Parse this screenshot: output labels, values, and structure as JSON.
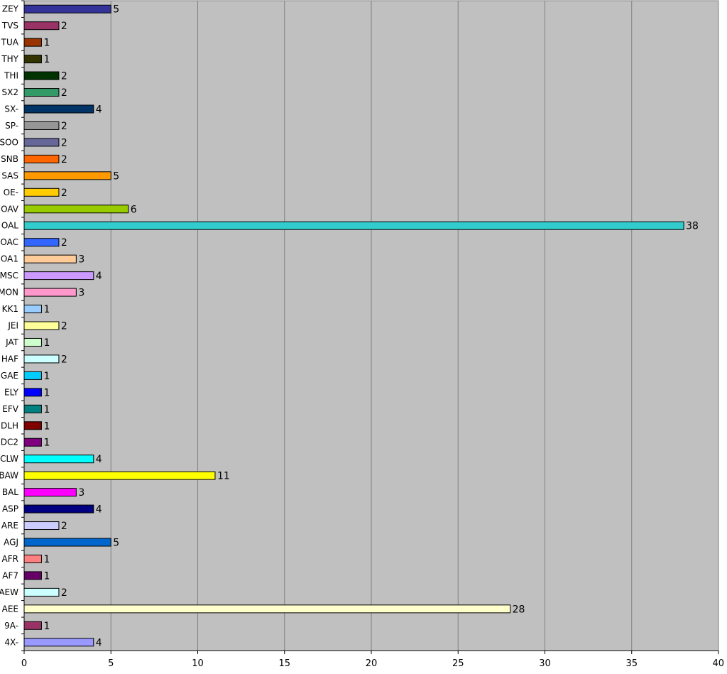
{
  "chart_data": {
    "type": "bar",
    "orientation": "horizontal",
    "title": "",
    "xlabel": "",
    "ylabel": "",
    "xlim": [
      0,
      40
    ],
    "x_ticks": [
      0,
      5,
      10,
      15,
      20,
      25,
      30,
      35,
      40
    ],
    "grid": true,
    "legend": "none",
    "plot_background": "#C0C0C0",
    "gridline_color": "#808080",
    "data_labels": true,
    "categories": [
      "4X-",
      "9A-",
      "AEE",
      "AEW",
      "AF7",
      "AFR",
      "AGJ",
      "ARE",
      "ASP",
      "BAL",
      "BAW",
      "CLW",
      "DC2",
      "DLH",
      "EFV",
      "ELY",
      "GAE",
      "HAF",
      "JAT",
      "JEI",
      "KK1",
      "MON",
      "MSC",
      "OA1",
      "OAC",
      "OAL",
      "OAV",
      "OE-",
      "SAS",
      "SNB",
      "SOO",
      "SP-",
      "SX-",
      "SX2",
      "THI",
      "THY",
      "TUA",
      "TVS",
      "ZEY"
    ],
    "values": [
      4,
      1,
      28,
      2,
      1,
      1,
      5,
      2,
      4,
      3,
      11,
      4,
      1,
      1,
      1,
      1,
      1,
      2,
      1,
      2,
      1,
      3,
      4,
      3,
      2,
      38,
      6,
      2,
      5,
      2,
      2,
      2,
      4,
      2,
      2,
      1,
      1,
      2,
      5
    ],
    "colors": [
      "#9999FF",
      "#993366",
      "#FFFFCC",
      "#CCFFFF",
      "#660066",
      "#FF8080",
      "#0066CC",
      "#CCCCFF",
      "#000080",
      "#FF00FF",
      "#FFFF00",
      "#00FFFF",
      "#800080",
      "#800000",
      "#008080",
      "#0000FF",
      "#00CCFF",
      "#CCFFFF",
      "#CCFFCC",
      "#FFFF99",
      "#99CCFF",
      "#FF99CC",
      "#CC99FF",
      "#FFCC99",
      "#3366FF",
      "#33CCCC",
      "#99CC00",
      "#FFCC00",
      "#FF9900",
      "#FF6600",
      "#666699",
      "#969696",
      "#003366",
      "#339966",
      "#003300",
      "#333300",
      "#993300",
      "#993366",
      "#333399"
    ]
  }
}
